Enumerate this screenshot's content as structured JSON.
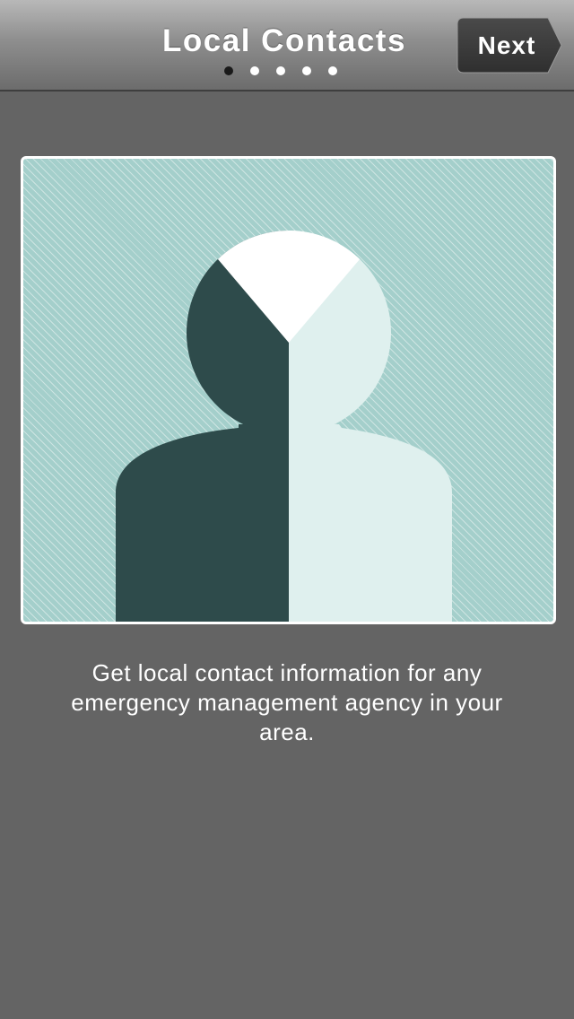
{
  "header": {
    "title": "Local Contacts",
    "next_label": "Next",
    "page_indicator": {
      "total": 5,
      "current": 1
    }
  },
  "illustration": {
    "icon": "person-silhouette-icon",
    "colors": {
      "background": "#a4cfcb",
      "dark": "#2e4b4b",
      "light": "#dff0ee",
      "face": "#ffffff"
    }
  },
  "description": "Get local contact information for any emergency management agency in your area."
}
